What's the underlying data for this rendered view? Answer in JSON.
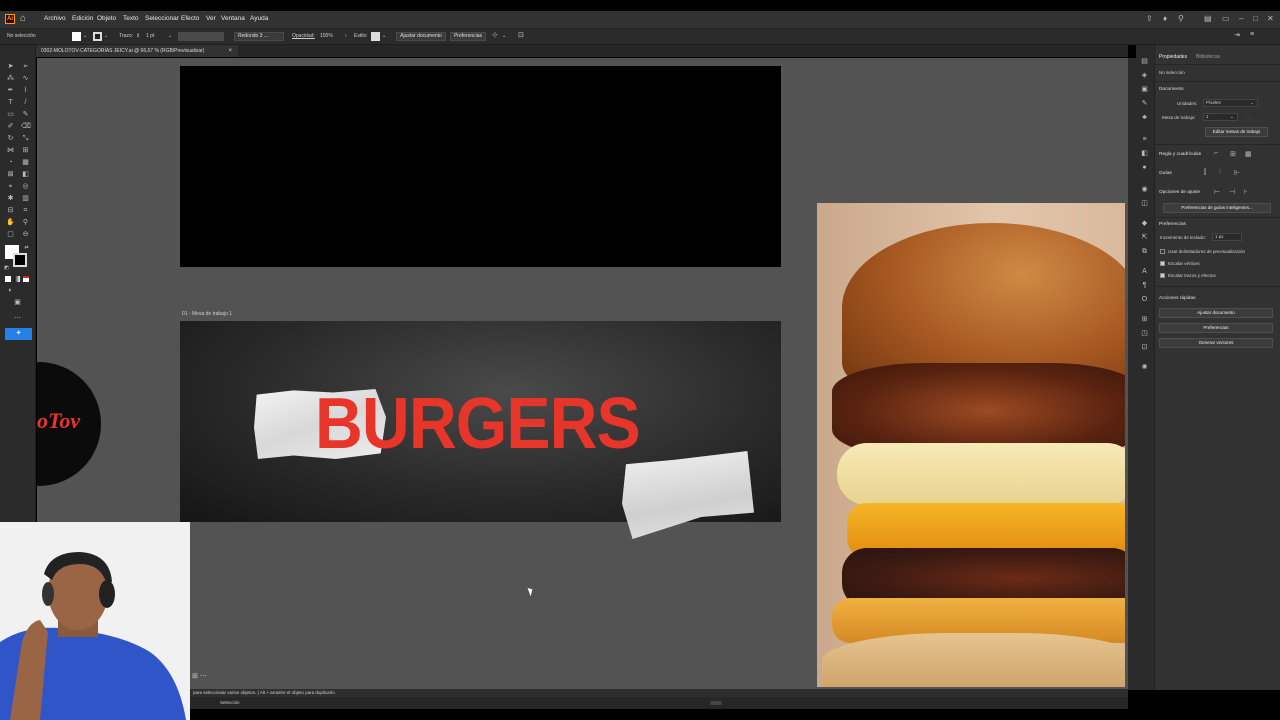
{
  "app": {
    "logo": "Ai"
  },
  "menu": [
    "Archivo",
    "Edición",
    "Objeto",
    "Texto",
    "Seleccionar",
    "Efecto",
    "Ver",
    "Ventana",
    "Ayuda"
  ],
  "control_bar": {
    "selection": "No selección",
    "stroke_label": "Trazo:",
    "stroke_value": "1 pt",
    "brush_value": "Redondo 3 ...",
    "opacity_label": "Opacidad:",
    "opacity_value": "100%",
    "style_label": "Estilo:",
    "adjust_doc": "Ajustar documento",
    "preferences": "Preferencias"
  },
  "document_tab": {
    "title": "0302-MOLOTOV-CATEGORÍAS JEICY.ai @ 66,67 % (RGB/Previsualizar)",
    "close": "×"
  },
  "canvas": {
    "artboard_label": "01 - Mesa de trabajo 1",
    "banner_text": "BURGERS",
    "logo_text": "oTov",
    "accent_color": "#e8352a"
  },
  "status": {
    "hint": "para seleccionar varios objetos. | Alt + arrastre el objeto para duplicarlo.",
    "tool": "Selección"
  },
  "panel": {
    "tabs": [
      "Propiedades",
      "Bibliotecas"
    ],
    "no_selection": "No selección",
    "document_heading": "Documento",
    "units_label": "Unidades:",
    "units_value": "Píxeles",
    "artboard_label": "Mesa de trabajo:",
    "artboard_value": "1",
    "edit_artboards": "Editar mesas de trabajo",
    "rulers_heading": "Regla y cuadrículas",
    "guides_heading": "Guías",
    "snap_heading": "Opciones de ajuste",
    "smart_guides_btn": "Preferencias de guías inteligentes...",
    "prefs_heading": "Preferencias",
    "keyboard_inc_label": "Incremento de teclado:",
    "keyboard_inc_value": "1 px",
    "chk_preview": "Usar delimitadores de previsualización",
    "chk_corners": "Escalar vértices",
    "chk_strokes": "Escalar trazos y efectos",
    "quick_heading": "Acciones rápidas",
    "quick_actions": [
      "Ajustar documento",
      "Preferencias",
      "Generar vectores"
    ]
  }
}
